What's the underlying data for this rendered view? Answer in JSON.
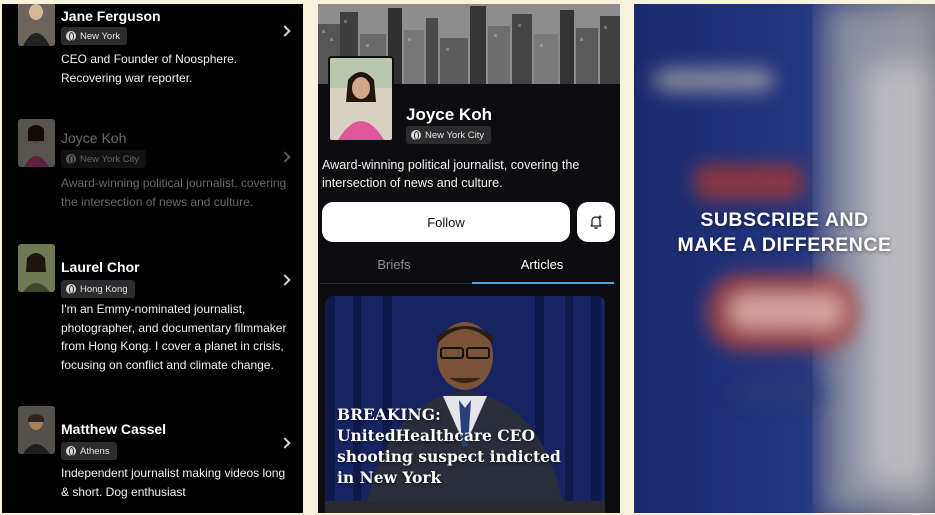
{
  "journalists": [
    {
      "name": "Jane Ferguson",
      "location": "New York",
      "bio": "CEO and Founder of Noosphere. Recovering war reporter."
    },
    {
      "name": "Joyce Koh",
      "location": "New York City",
      "bio": "Award-winning political journalist, covering the intersection of news and culture."
    },
    {
      "name": "Laurel Chor",
      "location": "Hong Kong",
      "bio": "I'm an Emmy-nominated journalist, photographer, and documentary filmmaker from Hong Kong. I cover a planet in crisis, focusing on conflict and climate change."
    },
    {
      "name": "Matthew Cassel",
      "location": "Athens",
      "bio": "Independent journalist making videos long & short. Dog enthusiast"
    }
  ],
  "profile": {
    "name": "Joyce Koh",
    "location": "New York City",
    "bio": "Award-winning political journalist, covering the intersection of news and culture.",
    "follow_label": "Follow",
    "tabs": [
      "Briefs",
      "Articles"
    ],
    "active_tab": "Articles",
    "article": {
      "headline": "BREAKING: UnitedHealthcare CEO shooting suspect indicted in New York"
    }
  },
  "promo": {
    "line1": "SUBSCRIBE AND",
    "line2": "MAKE A DIFFERENCE"
  },
  "colors": {
    "accent_underline": "#4aa3e8",
    "promo_bg": "#1c2c6e",
    "panel_bg": "#000000",
    "page_bg": "#f6f2dc"
  }
}
